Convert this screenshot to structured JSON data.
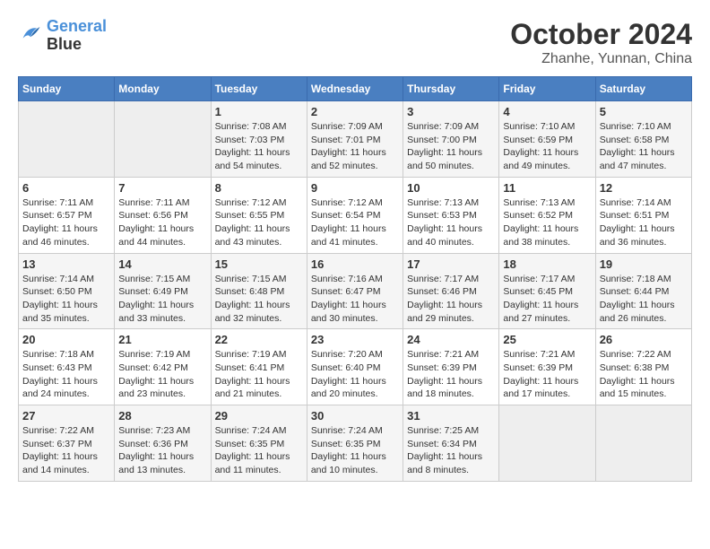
{
  "header": {
    "logo_line1": "General",
    "logo_line2": "Blue",
    "title": "October 2024",
    "subtitle": "Zhanhe, Yunnan, China"
  },
  "days_of_week": [
    "Sunday",
    "Monday",
    "Tuesday",
    "Wednesday",
    "Thursday",
    "Friday",
    "Saturday"
  ],
  "weeks": [
    [
      {
        "day": "",
        "empty": true
      },
      {
        "day": "",
        "empty": true
      },
      {
        "day": "1",
        "sunrise": "Sunrise: 7:08 AM",
        "sunset": "Sunset: 7:03 PM",
        "daylight": "Daylight: 11 hours and 54 minutes."
      },
      {
        "day": "2",
        "sunrise": "Sunrise: 7:09 AM",
        "sunset": "Sunset: 7:01 PM",
        "daylight": "Daylight: 11 hours and 52 minutes."
      },
      {
        "day": "3",
        "sunrise": "Sunrise: 7:09 AM",
        "sunset": "Sunset: 7:00 PM",
        "daylight": "Daylight: 11 hours and 50 minutes."
      },
      {
        "day": "4",
        "sunrise": "Sunrise: 7:10 AM",
        "sunset": "Sunset: 6:59 PM",
        "daylight": "Daylight: 11 hours and 49 minutes."
      },
      {
        "day": "5",
        "sunrise": "Sunrise: 7:10 AM",
        "sunset": "Sunset: 6:58 PM",
        "daylight": "Daylight: 11 hours and 47 minutes."
      }
    ],
    [
      {
        "day": "6",
        "sunrise": "Sunrise: 7:11 AM",
        "sunset": "Sunset: 6:57 PM",
        "daylight": "Daylight: 11 hours and 46 minutes."
      },
      {
        "day": "7",
        "sunrise": "Sunrise: 7:11 AM",
        "sunset": "Sunset: 6:56 PM",
        "daylight": "Daylight: 11 hours and 44 minutes."
      },
      {
        "day": "8",
        "sunrise": "Sunrise: 7:12 AM",
        "sunset": "Sunset: 6:55 PM",
        "daylight": "Daylight: 11 hours and 43 minutes."
      },
      {
        "day": "9",
        "sunrise": "Sunrise: 7:12 AM",
        "sunset": "Sunset: 6:54 PM",
        "daylight": "Daylight: 11 hours and 41 minutes."
      },
      {
        "day": "10",
        "sunrise": "Sunrise: 7:13 AM",
        "sunset": "Sunset: 6:53 PM",
        "daylight": "Daylight: 11 hours and 40 minutes."
      },
      {
        "day": "11",
        "sunrise": "Sunrise: 7:13 AM",
        "sunset": "Sunset: 6:52 PM",
        "daylight": "Daylight: 11 hours and 38 minutes."
      },
      {
        "day": "12",
        "sunrise": "Sunrise: 7:14 AM",
        "sunset": "Sunset: 6:51 PM",
        "daylight": "Daylight: 11 hours and 36 minutes."
      }
    ],
    [
      {
        "day": "13",
        "sunrise": "Sunrise: 7:14 AM",
        "sunset": "Sunset: 6:50 PM",
        "daylight": "Daylight: 11 hours and 35 minutes."
      },
      {
        "day": "14",
        "sunrise": "Sunrise: 7:15 AM",
        "sunset": "Sunset: 6:49 PM",
        "daylight": "Daylight: 11 hours and 33 minutes."
      },
      {
        "day": "15",
        "sunrise": "Sunrise: 7:15 AM",
        "sunset": "Sunset: 6:48 PM",
        "daylight": "Daylight: 11 hours and 32 minutes."
      },
      {
        "day": "16",
        "sunrise": "Sunrise: 7:16 AM",
        "sunset": "Sunset: 6:47 PM",
        "daylight": "Daylight: 11 hours and 30 minutes."
      },
      {
        "day": "17",
        "sunrise": "Sunrise: 7:17 AM",
        "sunset": "Sunset: 6:46 PM",
        "daylight": "Daylight: 11 hours and 29 minutes."
      },
      {
        "day": "18",
        "sunrise": "Sunrise: 7:17 AM",
        "sunset": "Sunset: 6:45 PM",
        "daylight": "Daylight: 11 hours and 27 minutes."
      },
      {
        "day": "19",
        "sunrise": "Sunrise: 7:18 AM",
        "sunset": "Sunset: 6:44 PM",
        "daylight": "Daylight: 11 hours and 26 minutes."
      }
    ],
    [
      {
        "day": "20",
        "sunrise": "Sunrise: 7:18 AM",
        "sunset": "Sunset: 6:43 PM",
        "daylight": "Daylight: 11 hours and 24 minutes."
      },
      {
        "day": "21",
        "sunrise": "Sunrise: 7:19 AM",
        "sunset": "Sunset: 6:42 PM",
        "daylight": "Daylight: 11 hours and 23 minutes."
      },
      {
        "day": "22",
        "sunrise": "Sunrise: 7:19 AM",
        "sunset": "Sunset: 6:41 PM",
        "daylight": "Daylight: 11 hours and 21 minutes."
      },
      {
        "day": "23",
        "sunrise": "Sunrise: 7:20 AM",
        "sunset": "Sunset: 6:40 PM",
        "daylight": "Daylight: 11 hours and 20 minutes."
      },
      {
        "day": "24",
        "sunrise": "Sunrise: 7:21 AM",
        "sunset": "Sunset: 6:39 PM",
        "daylight": "Daylight: 11 hours and 18 minutes."
      },
      {
        "day": "25",
        "sunrise": "Sunrise: 7:21 AM",
        "sunset": "Sunset: 6:39 PM",
        "daylight": "Daylight: 11 hours and 17 minutes."
      },
      {
        "day": "26",
        "sunrise": "Sunrise: 7:22 AM",
        "sunset": "Sunset: 6:38 PM",
        "daylight": "Daylight: 11 hours and 15 minutes."
      }
    ],
    [
      {
        "day": "27",
        "sunrise": "Sunrise: 7:22 AM",
        "sunset": "Sunset: 6:37 PM",
        "daylight": "Daylight: 11 hours and 14 minutes."
      },
      {
        "day": "28",
        "sunrise": "Sunrise: 7:23 AM",
        "sunset": "Sunset: 6:36 PM",
        "daylight": "Daylight: 11 hours and 13 minutes."
      },
      {
        "day": "29",
        "sunrise": "Sunrise: 7:24 AM",
        "sunset": "Sunset: 6:35 PM",
        "daylight": "Daylight: 11 hours and 11 minutes."
      },
      {
        "day": "30",
        "sunrise": "Sunrise: 7:24 AM",
        "sunset": "Sunset: 6:35 PM",
        "daylight": "Daylight: 11 hours and 10 minutes."
      },
      {
        "day": "31",
        "sunrise": "Sunrise: 7:25 AM",
        "sunset": "Sunset: 6:34 PM",
        "daylight": "Daylight: 11 hours and 8 minutes."
      },
      {
        "day": "",
        "empty": true
      },
      {
        "day": "",
        "empty": true
      }
    ]
  ]
}
